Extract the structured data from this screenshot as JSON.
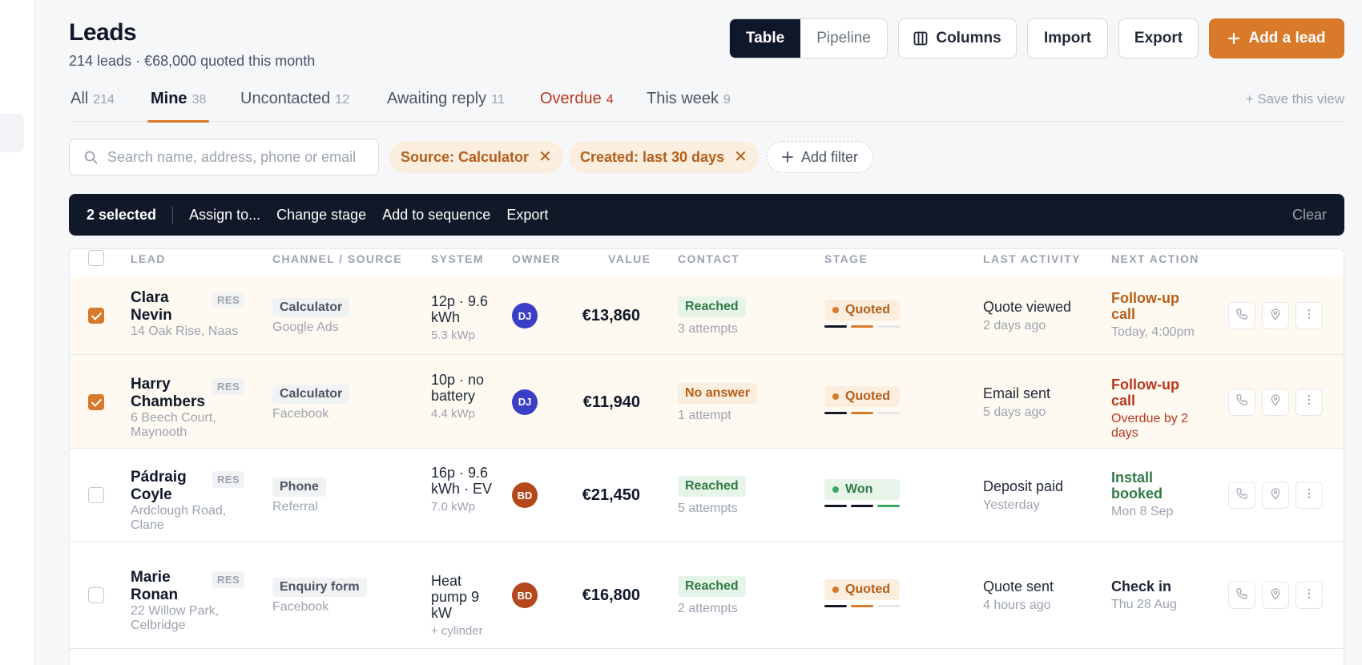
{
  "header": {
    "title": "Leads",
    "subtitle": "214 leads · €68,000 quoted this month"
  },
  "view_toggle": {
    "table": "Table",
    "pipeline": "Pipeline",
    "selected": "Table"
  },
  "toolbar": {
    "columns_label": "Columns",
    "import_label": "Import",
    "export_label": "Export",
    "add_label": "Add a lead"
  },
  "tabs": [
    {
      "label": "All",
      "count": "214"
    },
    {
      "label": "Mine",
      "count": "38"
    },
    {
      "label": "Uncontacted",
      "count": "12"
    },
    {
      "label": "Awaiting reply",
      "count": "11"
    },
    {
      "label": "Overdue",
      "count": "4"
    },
    {
      "label": "This week",
      "count": "9"
    }
  ],
  "active_tab": "Mine",
  "save_view_label": "+ Save this view",
  "search": {
    "placeholder": "Search name, address, phone or email",
    "value": ""
  },
  "filters": [
    {
      "label": "Source: Calculator"
    },
    {
      "label": "Created: last 30 days"
    }
  ],
  "add_filter_label": "Add filter",
  "bulk": {
    "selected_label": "2 selected",
    "assign": "Assign to...",
    "change_stage": "Change stage",
    "add_to_sequence": "Add to sequence",
    "export": "Export",
    "clear": "Clear"
  },
  "table": {
    "columns": {
      "lead": "LEAD",
      "channel": "CHANNEL / SOURCE",
      "system": "SYSTEM",
      "owner": "OWNER",
      "value": "VALUE",
      "contact": "CONTACT",
      "stage": "STAGE",
      "last_activity": "LAST ACTIVITY",
      "next_action": "NEXT ACTION"
    },
    "rows": [
      {
        "selected": true,
        "name": "Clara Nevin",
        "tag": "RES",
        "address": "14 Oak Rise, Naas",
        "channel": "Calculator",
        "source": "Google Ads",
        "system": "12p · 9.6 kWh",
        "system_sub": "5.3 kWp",
        "owner": "DJ",
        "owner_color": "#3b3fc6",
        "value": "€13,860",
        "contact": "Reached",
        "contact_tone": "green",
        "attempts": "3 attempts",
        "stage": "Quoted",
        "stage_progress": 2,
        "activity": "Quote viewed",
        "activity_time": "2 days ago",
        "next": "Follow-up call",
        "next_tone": "orange",
        "next_sub": "Today, 4:00pm",
        "next_sub_tone": "grey"
      },
      {
        "selected": true,
        "name": "Harry Chambers",
        "tag": "RES",
        "address": "6 Beech Court, Maynooth",
        "channel": "Calculator",
        "source": "Facebook",
        "system": "10p · no battery",
        "system_sub": "4.4 kWp",
        "owner": "DJ",
        "owner_color": "#3b3fc6",
        "value": "€11,940",
        "contact": "No answer",
        "contact_tone": "orange",
        "attempts": "1 attempt",
        "stage": "Quoted",
        "stage_progress": 2,
        "activity": "Email sent",
        "activity_time": "5 days ago",
        "next": "Follow-up call",
        "next_tone": "red",
        "next_sub": "Overdue by 2 days",
        "next_sub_tone": "red"
      },
      {
        "selected": false,
        "name": "Pádraig Coyle",
        "tag": "RES",
        "address": "Ardclough Road, Clane",
        "channel": "Phone",
        "source": "Referral",
        "system": "16p · 9.6 kWh · EV",
        "system_sub": "7.0 kWp",
        "owner": "BD",
        "owner_color": "#b5471c",
        "value": "€21,450",
        "contact": "Reached",
        "contact_tone": "green",
        "attempts": "5 attempts",
        "stage": "Won",
        "stage_progress": 3,
        "activity": "Deposit paid",
        "activity_time": "Yesterday",
        "next": "Install booked",
        "next_tone": "green",
        "next_sub": "Mon 8 Sep",
        "next_sub_tone": "grey"
      },
      {
        "selected": false,
        "name": "Marie Ronan",
        "tag": "RES",
        "address": "22 Willow Park, Celbridge",
        "channel": "Enquiry form",
        "source": "Facebook",
        "system": "Heat pump 9 kW",
        "system_sub": "+ cylinder",
        "owner": "BD",
        "owner_color": "#b5471c",
        "value": "€16,800",
        "contact": "Reached",
        "contact_tone": "green",
        "attempts": "2 attempts",
        "stage": "Quoted",
        "stage_progress": 2,
        "activity": "Quote sent",
        "activity_time": "4 hours ago",
        "next": "Check in",
        "next_tone": "dark",
        "next_sub": "Thu 28 Aug",
        "next_sub_tone": "grey"
      }
    ]
  },
  "colors": {
    "accent": "#d97a2b",
    "dark": "#0f172a",
    "overdue": "#b8381e",
    "won": "#2f7a44"
  },
  "icons": [
    "search-icon",
    "columns-icon",
    "plus-icon",
    "close-icon",
    "phone-icon",
    "map-pin-icon",
    "more-vertical-icon"
  ]
}
